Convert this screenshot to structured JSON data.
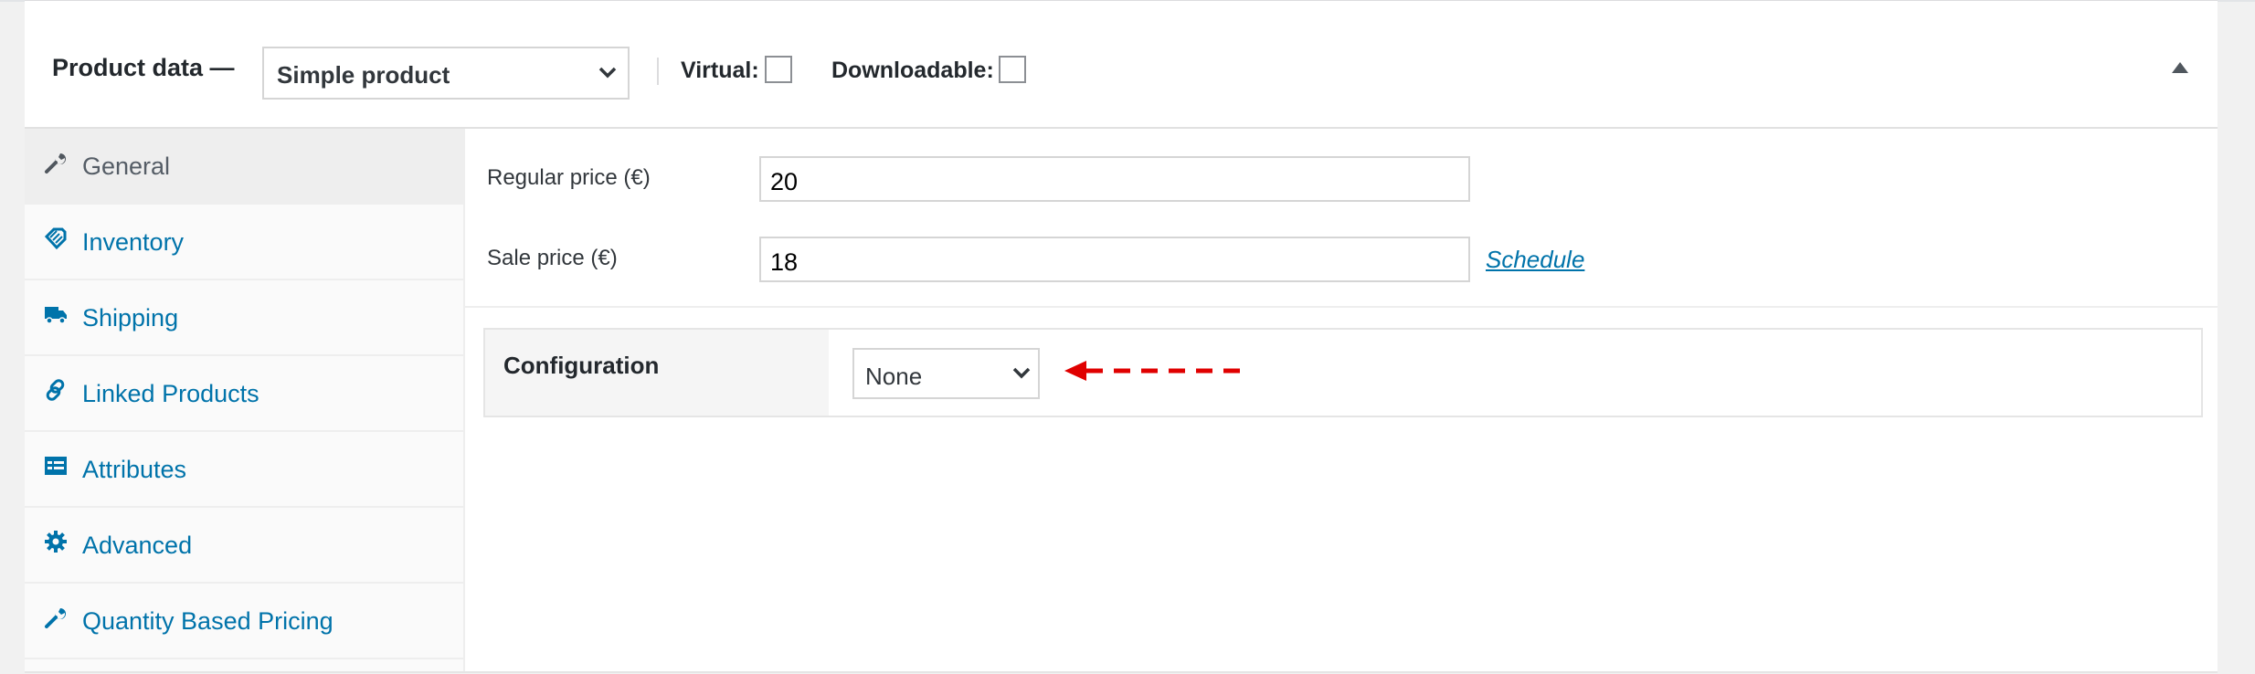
{
  "header": {
    "title": "Product data —",
    "product_type": "Simple product",
    "virtual_label": "Virtual:",
    "downloadable_label": "Downloadable:"
  },
  "sidebar": {
    "items": [
      {
        "label": "General",
        "icon": "wrench-icon",
        "active": true
      },
      {
        "label": "Inventory",
        "icon": "tag-icon",
        "active": false
      },
      {
        "label": "Shipping",
        "icon": "truck-icon",
        "active": false
      },
      {
        "label": "Linked Products",
        "icon": "link-icon",
        "active": false
      },
      {
        "label": "Attributes",
        "icon": "list-icon",
        "active": false
      },
      {
        "label": "Advanced",
        "icon": "gear-icon",
        "active": false
      },
      {
        "label": "Quantity Based Pricing",
        "icon": "wrench-icon",
        "active": false
      }
    ]
  },
  "general": {
    "regular_price_label": "Regular price (€)",
    "regular_price_value": "20",
    "sale_price_label": "Sale price (€)",
    "sale_price_value": "18",
    "schedule_link": "Schedule"
  },
  "configuration": {
    "label": "Configuration",
    "selected": "None",
    "annotation": "red-dashed-arrow"
  },
  "colors": {
    "link": "#0073aa",
    "active_tab_bg": "#eeeeee",
    "annotation_arrow": "#e00000"
  }
}
